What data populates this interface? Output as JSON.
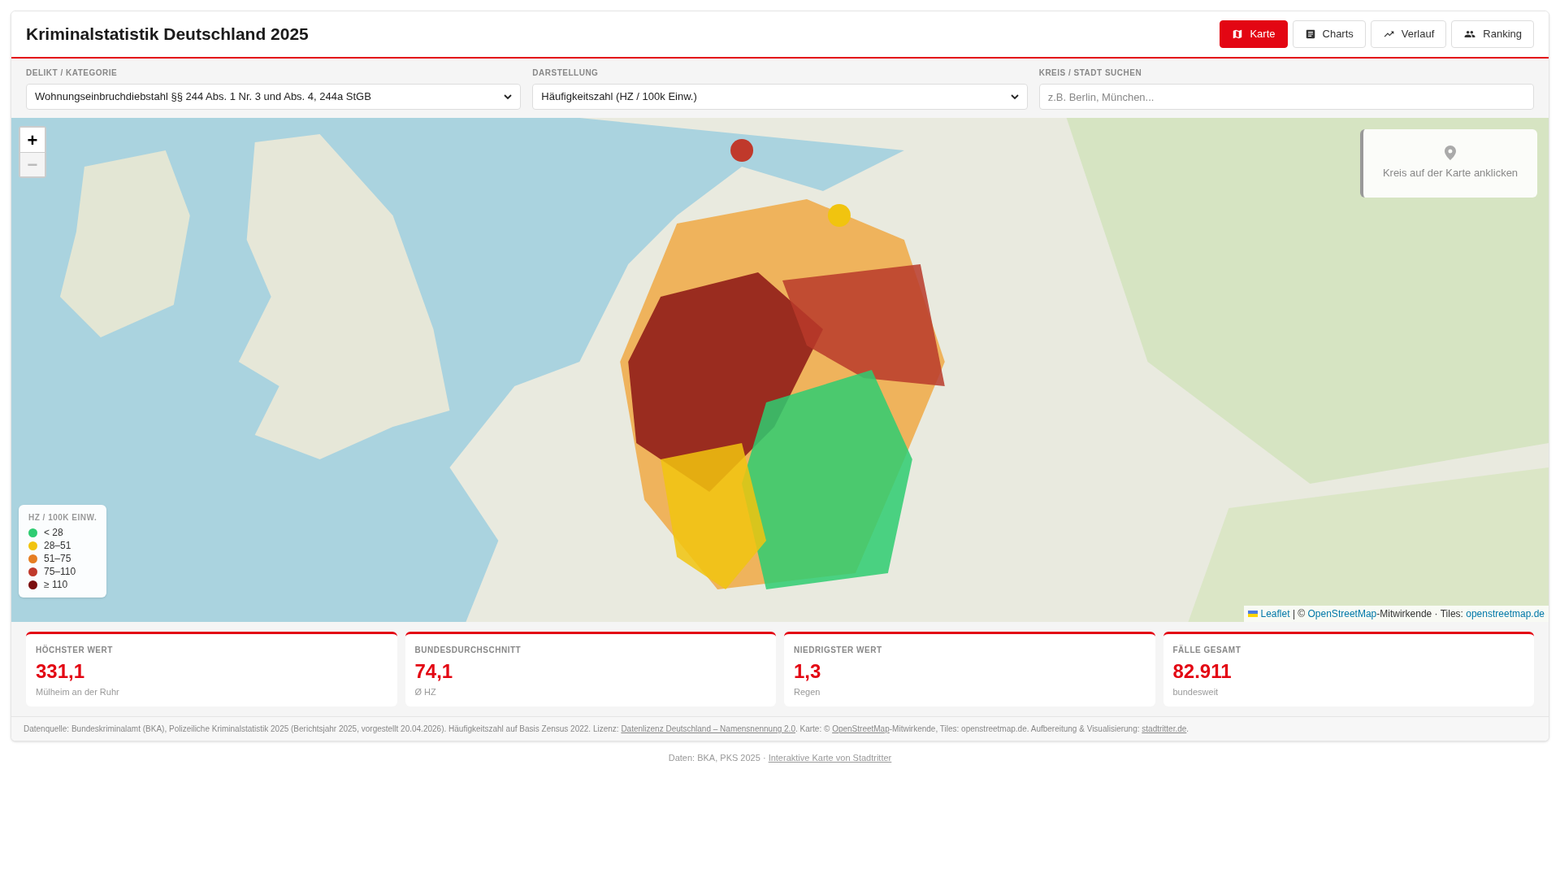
{
  "header": {
    "title": "Kriminalstatistik Deutschland 2025"
  },
  "view_tabs": [
    {
      "label": "Karte",
      "selected": true
    },
    {
      "label": "Charts",
      "selected": false
    },
    {
      "label": "Verlauf",
      "selected": false
    },
    {
      "label": "Ranking",
      "selected": false
    }
  ],
  "filters": [
    {
      "kind": "select",
      "label": "DELIKT / KATEGORIE",
      "value": "Wohnungseinbruchdiebstahl §§ 244 Abs. 1 Nr. 3 und Abs. 4, 244a StGB"
    },
    {
      "kind": "select",
      "label": "DARSTELLUNG",
      "value": "Häufigkeitszahl (HZ / 100k Einw.)"
    },
    {
      "kind": "search",
      "label": "KREIS / STADT SUCHEN",
      "placeholder": "z.B. Berlin, München..."
    }
  ],
  "map": {
    "zoom_controls": [
      {
        "label": "+",
        "disabled": false
      },
      {
        "label": "−",
        "disabled": true
      }
    ],
    "info_box": {
      "text": "Kreis auf der Karte anklicken"
    },
    "legend": {
      "title": "HZ / 100K EINW.",
      "items": [
        {
          "label": "< 28",
          "color": "#2ecc71"
        },
        {
          "label": "28–51",
          "color": "#f1c40f"
        },
        {
          "label": "51–75",
          "color": "#e67e22"
        },
        {
          "label": "75–110",
          "color": "#c0392b"
        },
        {
          "label": "≥ 110",
          "color": "#7b0e0e"
        }
      ]
    },
    "attribution": [
      {
        "text": "Leaflet",
        "kind": "link"
      },
      {
        "text": " | © ",
        "kind": "text"
      },
      {
        "text": "OpenStreetMap",
        "kind": "link"
      },
      {
        "text": "-Mitwirkende · Tiles: ",
        "kind": "text"
      },
      {
        "text": "openstreetmap.de",
        "kind": "link"
      }
    ]
  },
  "stats": [
    {
      "label": "HÖCHSTER WERT",
      "value": "331,1",
      "sub": "Mülheim an der Ruhr"
    },
    {
      "label": "BUNDESDURCHSCHNITT",
      "value": "74,1",
      "sub": "Ø HZ"
    },
    {
      "label": "NIEDRIGSTER WERT",
      "value": "1,3",
      "sub": "Regen"
    },
    {
      "label": "FÄLLE GESAMT",
      "value": "82.911",
      "sub": "bundesweit"
    }
  ],
  "source_note": [
    {
      "kind": "text",
      "text": "Datenquelle: Bundeskriminalamt (BKA), Polizeiliche Kriminalstatistik 2025 (Berichtsjahr 2025, vorgestellt 20.04.2026). Häufigkeitszahl auf Basis Zensus 2022. Lizenz: "
    },
    {
      "kind": "link",
      "text": "Datenlizenz Deutschland – Namensnennung 2.0"
    },
    {
      "kind": "text",
      "text": ". Karte: © "
    },
    {
      "kind": "link",
      "text": "OpenStreetMap"
    },
    {
      "kind": "text",
      "text": "-Mitwirkende, Tiles: openstreetmap.de. Aufbereitung & Visualisierung: "
    },
    {
      "kind": "link",
      "text": "stadtritter.de"
    },
    {
      "kind": "text",
      "text": "."
    }
  ],
  "page_footer": [
    {
      "kind": "text",
      "text": "Daten: BKA, PKS 2025 · "
    },
    {
      "kind": "link",
      "text": "Interaktive Karte von Stadtritter"
    }
  ]
}
